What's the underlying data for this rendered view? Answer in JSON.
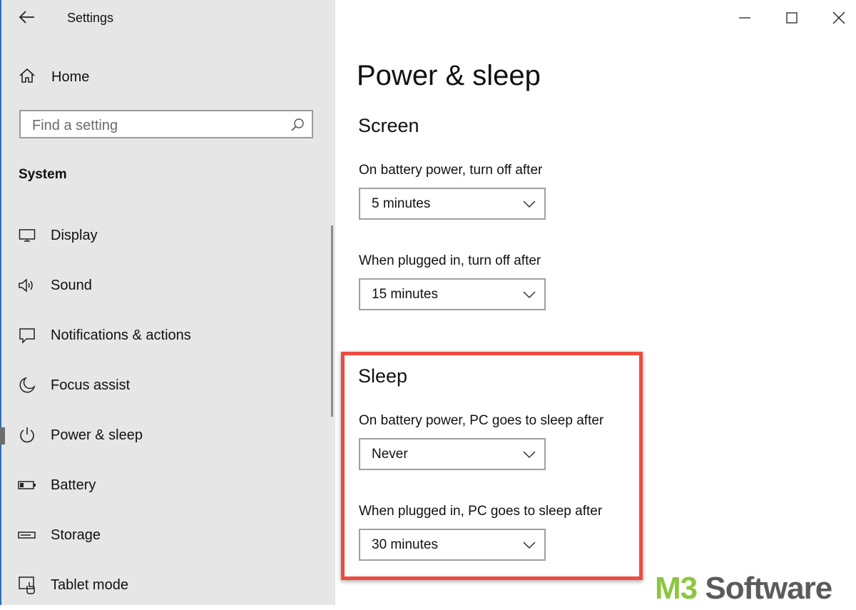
{
  "window": {
    "app_title": "Settings",
    "controls": {
      "minimize": "minimize-icon",
      "maximize": "maximize-icon",
      "close": "close-icon"
    }
  },
  "sidebar": {
    "home_label": "Home",
    "search": {
      "placeholder": "Find a setting",
      "value": ""
    },
    "section_label": "System",
    "items": [
      {
        "label": "Display",
        "icon": "monitor-icon"
      },
      {
        "label": "Sound",
        "icon": "speaker-icon"
      },
      {
        "label": "Notifications & actions",
        "icon": "notification-icon"
      },
      {
        "label": "Focus assist",
        "icon": "moon-icon"
      },
      {
        "label": "Power & sleep",
        "icon": "power-icon",
        "selected": true
      },
      {
        "label": "Battery",
        "icon": "battery-icon"
      },
      {
        "label": "Storage",
        "icon": "storage-icon"
      },
      {
        "label": "Tablet mode",
        "icon": "tablet-icon"
      }
    ]
  },
  "main": {
    "title": "Power & sleep",
    "screen": {
      "heading": "Screen",
      "battery_label": "On battery power, turn off after",
      "battery_value": "5 minutes",
      "plugged_label": "When plugged in, turn off after",
      "plugged_value": "15 minutes"
    },
    "sleep": {
      "heading": "Sleep",
      "battery_label": "On battery power, PC goes to sleep after",
      "battery_value": "Never",
      "plugged_label": "When plugged in, PC goes to sleep after",
      "plugged_value": "30 minutes"
    }
  },
  "overlay": {
    "highlight_color": "#ef4b3f",
    "watermark_part1": "M3",
    "watermark_part2": "Software",
    "watermark_color1": "#8cc63f",
    "watermark_color2": "#5b5b5b"
  }
}
